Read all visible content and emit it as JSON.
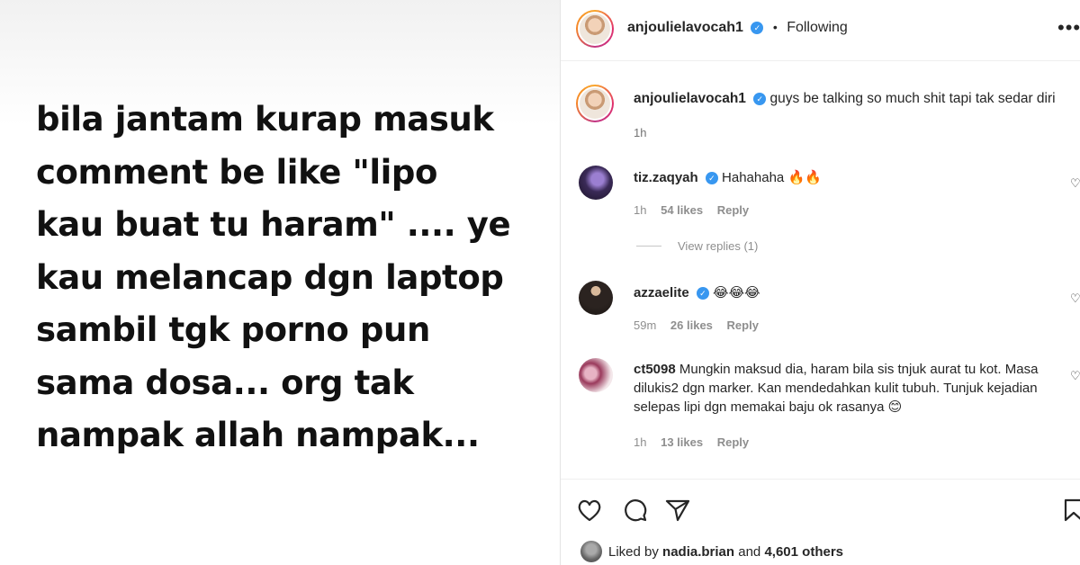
{
  "story": {
    "lines": [
      "bila jantam kurap masuk",
      "comment be like \"lipo",
      "kau buat tu haram\" .... ye",
      "kau melancap dgn laptop",
      "sambil tgk porno pun",
      "sama dosa... org tak",
      "nampak allah nampak..."
    ]
  },
  "post": {
    "header": {
      "username": "anjoulielavocah1",
      "verified_icon": "✓",
      "separator": "•",
      "following_label": "Following",
      "more_icon": "•••"
    },
    "caption": {
      "username": "anjoulielavocah1",
      "text": "guys be talking so much shit tapi tak sedar diri",
      "time": "1h"
    },
    "comments": [
      {
        "username": "tiz.zaqyah",
        "text": "Hahahaha",
        "emoji": "🔥🔥",
        "time": "1h",
        "likes": "54 likes",
        "reply_label": "Reply",
        "view_replies": "View replies (1)"
      },
      {
        "username": "azzaelite",
        "text": "",
        "emoji": "😂😂😂",
        "time": "59m",
        "likes": "26 likes",
        "reply_label": "Reply"
      },
      {
        "username": "ct5098",
        "text": "Mungkin maksud dia, haram bila sis tnjuk aurat tu kot. Masa dilukis2 dgn marker. Kan mendedahkan kulit tubuh. Tunjuk kejadian selepas lipi dgn memakai baju ok rasanya",
        "emoji": "😊",
        "time": "1h",
        "likes": "13 likes",
        "reply_label": "Reply"
      }
    ],
    "liked_by": {
      "prefix": "Liked by",
      "user": "nadia.brian",
      "middle": "and",
      "others": "4,601 others"
    }
  }
}
